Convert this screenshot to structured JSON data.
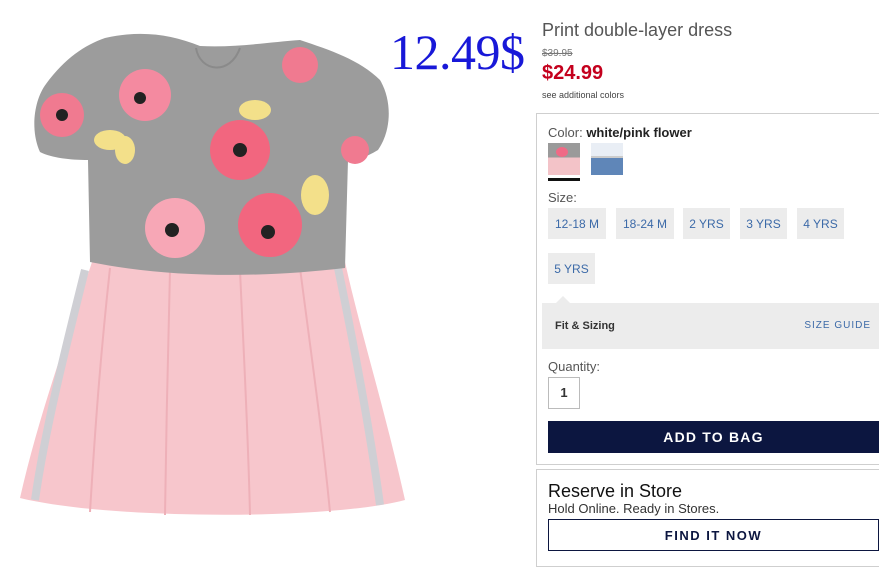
{
  "overlay": {
    "price": "12.49$",
    "color": "#1818d8"
  },
  "product": {
    "title": "Print double-layer dress",
    "old_price": "$39.95",
    "sale_price": "$24.99",
    "see_colors": "see additional colors",
    "image_icon": "product-photo"
  },
  "color": {
    "label": "Color:",
    "selected": "white/pink flower",
    "swatches": [
      "white/pink flower",
      "denim"
    ]
  },
  "size": {
    "label": "Size:",
    "options": [
      "12-18 M",
      "18-24 M",
      "2 YRS",
      "3 YRS",
      "4 YRS",
      "5 YRS"
    ]
  },
  "fit": {
    "title": "Fit & Sizing",
    "guide": "SIZE GUIDE"
  },
  "quantity": {
    "label": "Quantity:",
    "value": "1"
  },
  "cart": {
    "add_label": "ADD TO BAG",
    "color": "#0c1640"
  },
  "reserve": {
    "title": "Reserve in Store",
    "subtitle": "Hold Online. Ready in Stores.",
    "button": "FIND IT NOW"
  },
  "colors": {
    "sale": "#c4001d",
    "link": "#3c6aa8"
  }
}
